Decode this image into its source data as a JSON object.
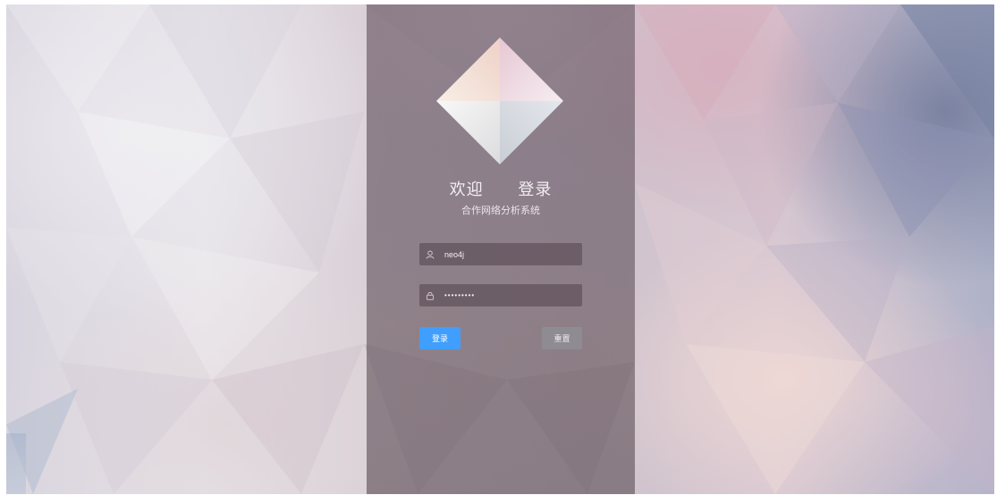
{
  "login": {
    "welcome_word1": "欢迎",
    "welcome_word2": "登录",
    "subtitle": "合作网络分析系统",
    "username_value": "neo4j",
    "password_value": "•••••••••",
    "login_label": "登录",
    "reset_label": "重置"
  },
  "icons": {
    "username": "user-icon",
    "password": "lock-icon",
    "logo": "diamond-logo"
  },
  "colors": {
    "primary_button": "#409eff",
    "reset_button": "#8e8b92",
    "panel_overlay": "#7a6a76"
  }
}
